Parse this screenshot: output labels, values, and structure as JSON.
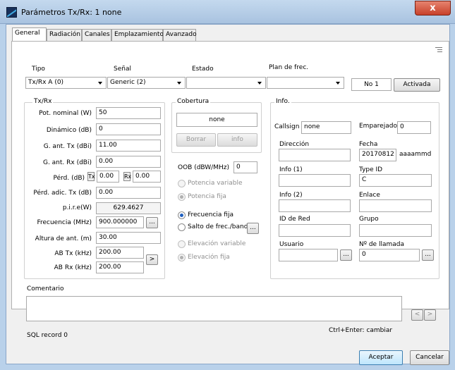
{
  "window": {
    "title": "Parámetros Tx/Rx: 1 none",
    "close_glyph": "x"
  },
  "tabs": [
    {
      "label": "General",
      "active": true
    },
    {
      "label": "Radiación"
    },
    {
      "label": "Canales"
    },
    {
      "label": "Emplazamiento"
    },
    {
      "label": "Avanzado"
    }
  ],
  "top": {
    "tipo_label": "Tipo",
    "tipo_value": "Tx/Rx A (0)",
    "senal_label": "Señal",
    "senal_value": "Generic (2)",
    "estado_label": "Estado",
    "estado_value": "",
    "plan_label": "Plan de frec.",
    "plan_value": "",
    "no_value": "No 1",
    "activada_label": "Activada"
  },
  "txrx": {
    "group_label": "Tx/Rx",
    "rows": [
      {
        "label": "Pot. nominal (W)",
        "value": "50"
      },
      {
        "label": "Dinámico (dB)",
        "value": "0"
      },
      {
        "label": "G. ant. Tx (dBi)",
        "value": "11.00"
      },
      {
        "label": "G. ant. Rx (dBi)",
        "value": "0.00"
      }
    ],
    "perd_label": "Pérd. (dB)",
    "perd_tx_tag": "Tx",
    "perd_tx_value": "0.00",
    "perd_rx_tag": "Rx",
    "perd_rx_value": "0.00",
    "perd_adic_label": "Pérd. adic. Tx (dB)",
    "perd_adic_value": "0.00",
    "pire_label": "p.i.r.e(W)",
    "pire_value": "629.4627",
    "freq_label": "Frecuencia (MHz)",
    "freq_value": "900.000000",
    "altura_label": "Altura de ant. (m)",
    "altura_value": "30.00",
    "abtx_label": "AB Tx (kHz)",
    "abtx_value": "200.00",
    "abrx_label": "AB Rx (kHz)",
    "abrx_value": "200.00",
    "dots": "...",
    "arrow": ">"
  },
  "cobertura": {
    "group_label": "Cobertura",
    "value": "none",
    "borrar": "Borrar",
    "info": "info"
  },
  "oob": {
    "label": "OOB (dBW/MHz)",
    "value": "0"
  },
  "radios": [
    {
      "label": "Potencia variable",
      "checked": false,
      "disabled": true
    },
    {
      "label": "Potencia fija",
      "checked": true,
      "disabled": true
    },
    {
      "label": "Frecuencia fija",
      "checked": true,
      "disabled": false
    },
    {
      "label": "Salto de frec./band",
      "checked": false,
      "disabled": false
    },
    {
      "label": "Elevación variable",
      "checked": false,
      "disabled": true
    },
    {
      "label": "Elevación fija",
      "checked": true,
      "disabled": true
    }
  ],
  "info": {
    "group_label": "Info.",
    "callsign_label": "Callsign",
    "callsign_value": "none",
    "emparejado_label": "Emparejado",
    "emparejado_value": "0",
    "direccion_label": "Dirección",
    "direccion_value": "",
    "fecha_label": "Fecha",
    "fecha_value": "20170812",
    "fecha_format": "aaaammdd",
    "info1_label": "Info (1)",
    "info1_value": "",
    "typeid_label": "Type ID",
    "typeid_value": "C",
    "info2_label": "Info (2)",
    "info2_value": "",
    "enlace_label": "Enlace",
    "enlace_value": "",
    "idred_label": "ID de Red",
    "idred_value": "",
    "grupo_label": "Grupo",
    "grupo_value": "",
    "usuario_label": "Usuario",
    "usuario_value": "",
    "llamada_label": "Nº de llamada",
    "llamada_value": "0"
  },
  "comentario": {
    "label": "Comentario",
    "value": "",
    "prev": "<",
    "next": ">"
  },
  "footer": {
    "sql": "SQL record 0",
    "hint": "Ctrl+Enter: cambiar",
    "aceptar": "Aceptar",
    "cancelar": "Cancelar"
  }
}
